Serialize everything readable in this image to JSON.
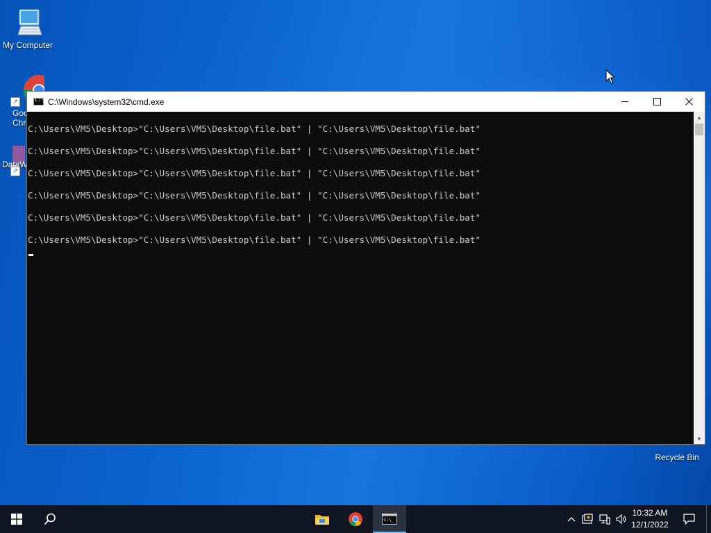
{
  "desktop": {
    "icons": [
      {
        "label": "My Computer"
      },
      {
        "label": "Google Chrome",
        "label_line1": "Goo",
        "label_line2": "Chr"
      },
      {
        "label": "DataW"
      },
      {
        "label": "Recycle Bin"
      }
    ]
  },
  "cmd": {
    "title": "C:\\Windows\\system32\\cmd.exe",
    "lines": [
      "C:\\Users\\VM5\\Desktop>\"C:\\Users\\VM5\\Desktop\\file.bat\" | \"C:\\Users\\VM5\\Desktop\\file.bat\"",
      "C:\\Users\\VM5\\Desktop>\"C:\\Users\\VM5\\Desktop\\file.bat\" | \"C:\\Users\\VM5\\Desktop\\file.bat\"",
      "C:\\Users\\VM5\\Desktop>\"C:\\Users\\VM5\\Desktop\\file.bat\" | \"C:\\Users\\VM5\\Desktop\\file.bat\"",
      "C:\\Users\\VM5\\Desktop>\"C:\\Users\\VM5\\Desktop\\file.bat\" | \"C:\\Users\\VM5\\Desktop\\file.bat\"",
      "C:\\Users\\VM5\\Desktop>\"C:\\Users\\VM5\\Desktop\\file.bat\" | \"C:\\Users\\VM5\\Desktop\\file.bat\"",
      "C:\\Users\\VM5\\Desktop>\"C:\\Users\\VM5\\Desktop\\file.bat\" | \"C:\\Users\\VM5\\Desktop\\file.bat\""
    ],
    "buttons": {
      "minimize": "minimize-icon",
      "maximize": "maximize-icon",
      "close": "close-icon"
    }
  },
  "taskbar": {
    "start_icon": "windows-logo-icon",
    "search_icon": "search-icon",
    "pinned": [
      "file-explorer-icon",
      "chrome-icon",
      "cmd-icon"
    ],
    "tray": {
      "time": "10:32 AM",
      "date": "12/1/2022",
      "icons": [
        "chevron-up-icon",
        "security-icon",
        "network-icon",
        "volume-icon",
        "notification-icon"
      ]
    }
  },
  "colors": {
    "console_bg": "#0c0c0c",
    "console_text": "#cccccc",
    "taskbar_bg": "#101621",
    "active_app_underline": "#76b9ed"
  }
}
